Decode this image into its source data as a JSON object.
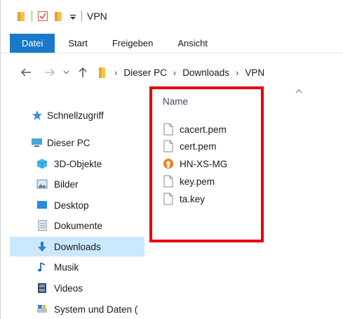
{
  "window": {
    "title": "VPN"
  },
  "ribbon": {
    "tabs": [
      {
        "label": "Datei",
        "active": true
      },
      {
        "label": "Start",
        "active": false
      },
      {
        "label": "Freigeben",
        "active": false
      },
      {
        "label": "Ansicht",
        "active": false
      }
    ]
  },
  "address": {
    "crumbs": [
      "Dieser PC",
      "Downloads",
      "VPN"
    ]
  },
  "sidebar": {
    "items": [
      {
        "label": "Schnellzugriff",
        "icon": "star-icon"
      },
      {
        "label": "Dieser PC",
        "icon": "computer-icon"
      },
      {
        "label": "3D-Objekte",
        "icon": "cube-icon"
      },
      {
        "label": "Bilder",
        "icon": "pictures-icon"
      },
      {
        "label": "Desktop",
        "icon": "desktop-icon"
      },
      {
        "label": "Dokumente",
        "icon": "documents-icon"
      },
      {
        "label": "Downloads",
        "icon": "download-icon",
        "selected": true
      },
      {
        "label": "Musik",
        "icon": "music-icon"
      },
      {
        "label": "Videos",
        "icon": "videos-icon"
      },
      {
        "label": "System und Daten (",
        "icon": "drive-icon"
      }
    ]
  },
  "filelist": {
    "column_header": "Name",
    "files": [
      {
        "name": "cacert.pem",
        "icon": "file-icon"
      },
      {
        "name": "cert.pem",
        "icon": "file-icon"
      },
      {
        "name": "HN-XS-MG",
        "icon": "openvpn-icon"
      },
      {
        "name": "key.pem",
        "icon": "file-icon"
      },
      {
        "name": "ta.key",
        "icon": "file-icon"
      }
    ]
  },
  "colors": {
    "accent": "#1979ca",
    "selection": "#cce8ff",
    "annotation_box": "#e8000b",
    "openvpn": "#f47b20"
  }
}
